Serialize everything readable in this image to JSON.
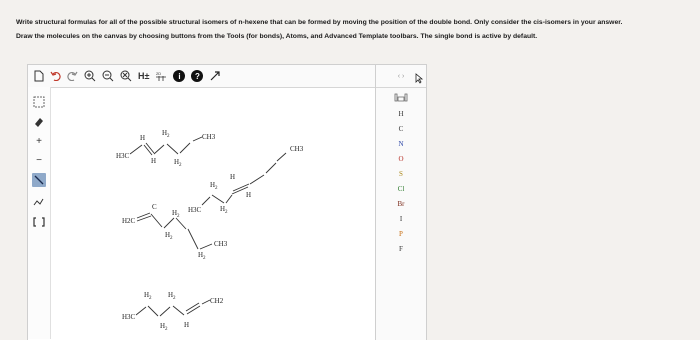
{
  "question": {
    "line1": "Write structural formulas for all of the possible structural isomers of n-hexene that can be formed by moving the position of the double bond. Only consider the cis-isomers in your answer.",
    "line2": "Draw the molecules on the canvas by choosing buttons from the Tools (for bonds), Atoms, and Advanced Template toolbars. The single bond is active by default."
  },
  "toolbar": {
    "buttons": [
      {
        "icon": "new-document-icon",
        "glyph": "🗋"
      },
      {
        "icon": "undo-icon",
        "glyph": "↶"
      },
      {
        "icon": "redo-icon",
        "glyph": "↷"
      },
      {
        "icon": "zoom-in-icon",
        "glyph": "⊕"
      },
      {
        "icon": "zoom-out-icon",
        "glyph": "⊖"
      },
      {
        "icon": "clear-icon",
        "glyph": "⊗"
      },
      {
        "icon": "explicit-hydrogens-icon",
        "glyph": "H±"
      },
      {
        "icon": "2d-clean-icon",
        "glyph": "⌗"
      },
      {
        "icon": "info-icon",
        "glyph": "i"
      },
      {
        "icon": "help-icon",
        "glyph": "?"
      },
      {
        "icon": "expand-icon",
        "glyph": "⤢"
      }
    ]
  },
  "atoms_panel": {
    "top_label": "‹ ›",
    "periodic_icon": "periodic-table-icon",
    "atoms": [
      {
        "symbol": "H",
        "color": "dark"
      },
      {
        "symbol": "C",
        "color": "dark"
      },
      {
        "symbol": "N",
        "color": "blue"
      },
      {
        "symbol": "O",
        "color": "red"
      },
      {
        "symbol": "S",
        "color": "gold"
      },
      {
        "symbol": "Cl",
        "color": "green"
      },
      {
        "symbol": "Br",
        "color": "maroon"
      },
      {
        "symbol": "I",
        "color": "dark"
      },
      {
        "symbol": "P",
        "color": "orange"
      },
      {
        "symbol": "F",
        "color": "dark"
      }
    ]
  },
  "molecules": {
    "labels": {
      "h3c": "H3C",
      "h2c": "H2C",
      "ch2": "CH2",
      "ch3": "CH3",
      "h": "H",
      "c": "C",
      "h2": "H2",
      "eq_c": "C"
    }
  }
}
